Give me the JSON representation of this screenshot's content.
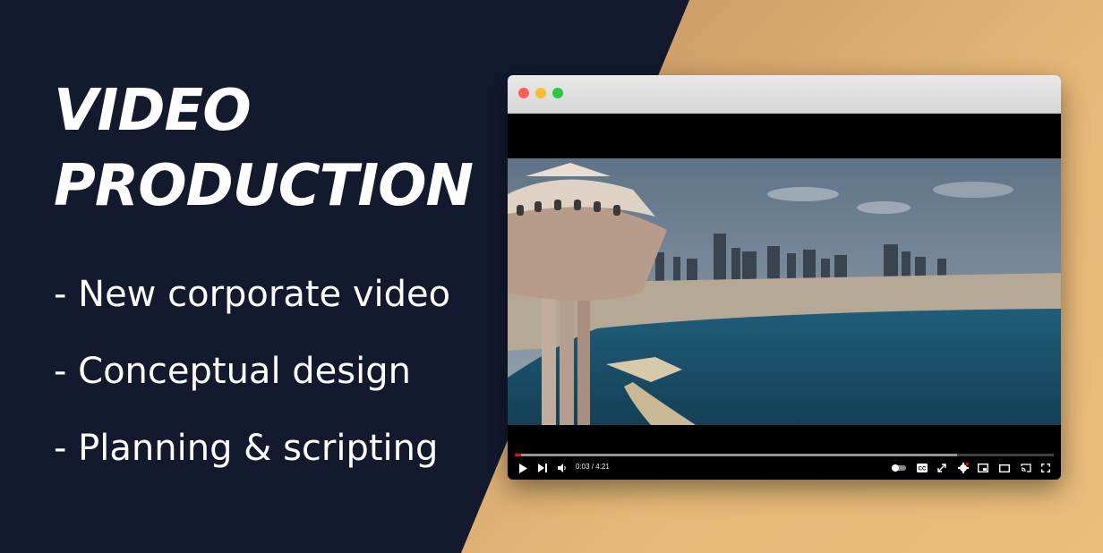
{
  "headline": {
    "line1": "VIDEO",
    "line2": "PRODUCTION"
  },
  "bullets": [
    "- New corporate video",
    "- Conceptual design",
    "- Planning & scripting"
  ],
  "player": {
    "time_current": "0:03",
    "time_separator": " / ",
    "time_total": "4:21",
    "progress_fraction": 0.012,
    "buffered_fraction": 0.82,
    "icons": [
      "play-icon",
      "next-icon",
      "volume-icon",
      "autoplay-toggle-icon",
      "captions-icon",
      "expand-icon",
      "settings-icon",
      "miniplayer-icon",
      "theater-icon",
      "cast-icon",
      "fullscreen-icon"
    ]
  },
  "colors": {
    "navy": "#131a2e",
    "gold": "#e6b978",
    "progress": "#ff0000"
  }
}
